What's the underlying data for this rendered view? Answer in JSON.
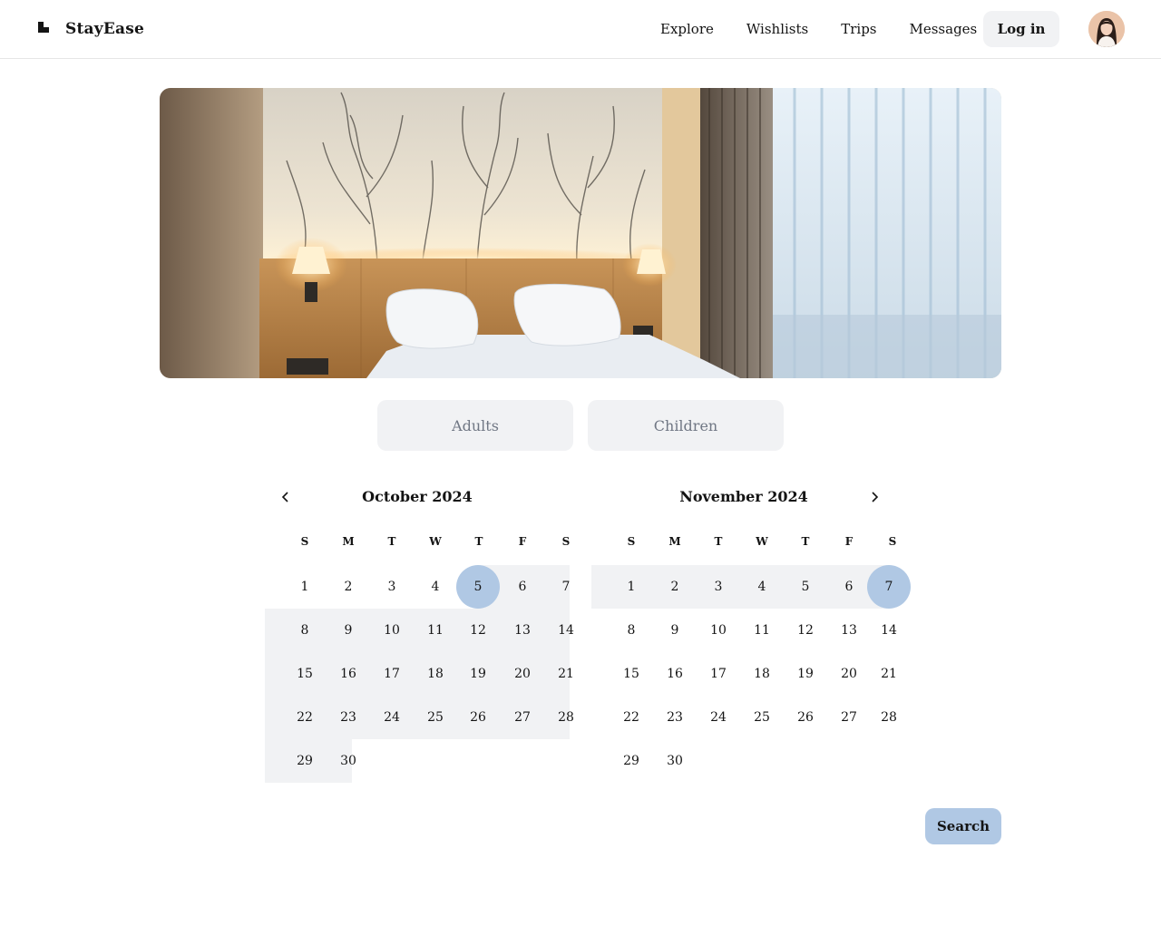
{
  "brand": {
    "name": "StayEase"
  },
  "nav": {
    "items": [
      "Explore",
      "Wishlists",
      "Trips",
      "Messages"
    ],
    "login_label": "Log in"
  },
  "guests": {
    "adults_placeholder": "Adults",
    "children_placeholder": "Children"
  },
  "calendar": {
    "weekdays": [
      "S",
      "M",
      "T",
      "W",
      "T",
      "F",
      "S"
    ],
    "months": [
      {
        "title": "October 2024",
        "first_weekday": 0,
        "days": 30,
        "selected_start": 5
      },
      {
        "title": "November 2024",
        "first_weekday": 0,
        "days": 30,
        "selected_end": 7
      }
    ]
  },
  "search_label": "Search",
  "colors": {
    "accent": "#b0c8e4",
    "range": "#f1f2f4",
    "text": "#141414"
  },
  "icons": {
    "prev": "chevron-left-icon",
    "next": "chevron-right-icon"
  }
}
